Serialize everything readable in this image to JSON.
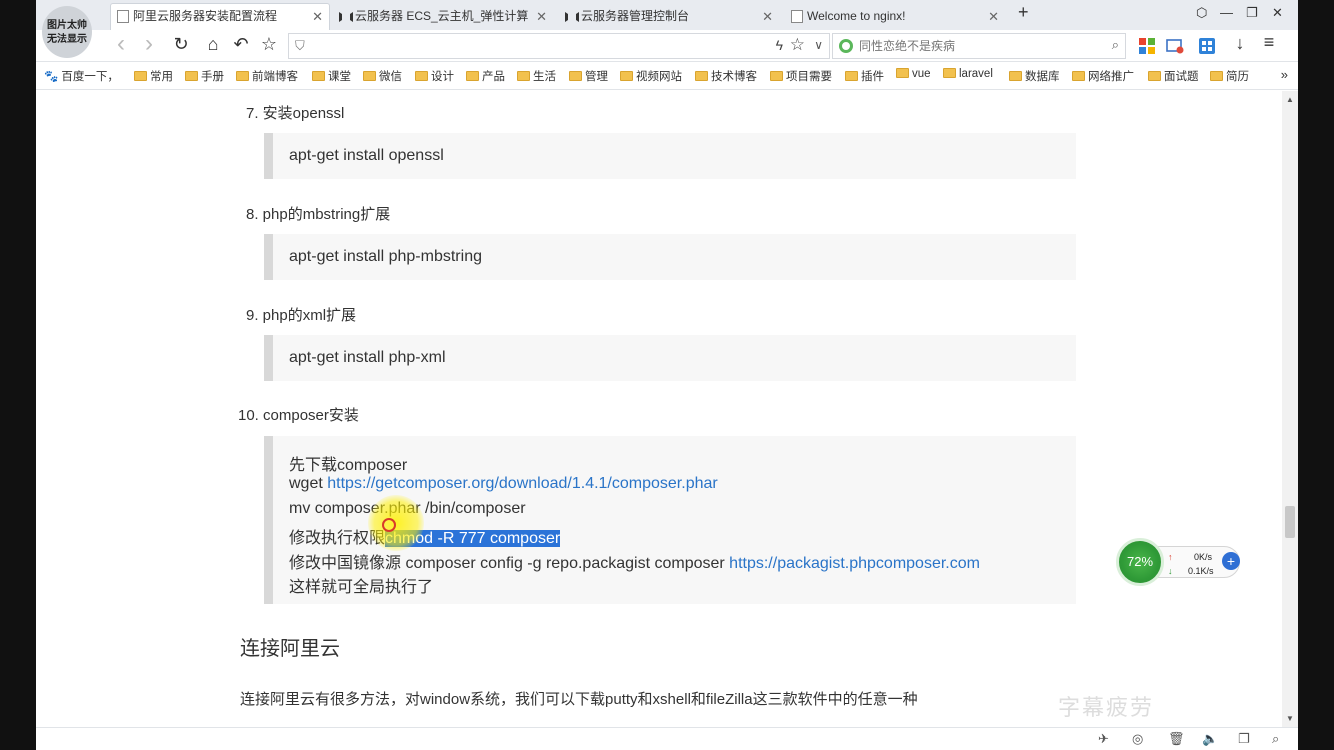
{
  "avatar": {
    "line1": "图片太帅",
    "line2": "无法显示"
  },
  "tabs": [
    {
      "title": "阿里云服务器安装配置流程",
      "icon": "page-icon",
      "active": true
    },
    {
      "title": "云服务器 ECS_云主机_弹性计算",
      "icon": "aliyun-icon",
      "active": false
    },
    {
      "title": "云服务器管理控制台",
      "icon": "aliyun-icon",
      "active": false
    },
    {
      "title": "Welcome to nginx!",
      "icon": "page-icon",
      "active": false
    }
  ],
  "tab_close": "✕",
  "new_tab": "+",
  "window": {
    "skin": "⬡",
    "minimize": "—",
    "restore": "❐",
    "close": "✕"
  },
  "nav": {
    "back": "‹",
    "forward": "›",
    "reload": "↻",
    "home": "⌂",
    "undo": "↶",
    "fav": "☆"
  },
  "address": {
    "value": "",
    "shield": "⛉",
    "bolt": "ϟ",
    "star": "☆",
    "dropdown": "∨"
  },
  "search": {
    "placeholder": "同性恋绝不是疾病",
    "go": "⌕"
  },
  "toolbar_right": {
    "download": "↓",
    "menu": "≡"
  },
  "bookmarks": [
    {
      "label": "百度一下，",
      "type": "paw"
    },
    {
      "label": "常用",
      "type": "folder"
    },
    {
      "label": "手册",
      "type": "folder"
    },
    {
      "label": "前端博客",
      "type": "folder"
    },
    {
      "label": "课堂",
      "type": "folder"
    },
    {
      "label": "微信",
      "type": "folder"
    },
    {
      "label": "设计",
      "type": "folder"
    },
    {
      "label": "产品",
      "type": "folder"
    },
    {
      "label": "生活",
      "type": "folder"
    },
    {
      "label": "管理",
      "type": "folder"
    },
    {
      "label": "视频网站",
      "type": "folder"
    },
    {
      "label": "技术博客",
      "type": "folder"
    },
    {
      "label": "项目需要",
      "type": "folder"
    },
    {
      "label": "插件",
      "type": "folder"
    },
    {
      "label": "vue",
      "type": "folder"
    },
    {
      "label": "laravel",
      "type": "folder"
    },
    {
      "label": "数据库",
      "type": "folder"
    },
    {
      "label": "网络推广",
      "type": "folder"
    },
    {
      "label": "面试题",
      "type": "folder"
    },
    {
      "label": "简历",
      "type": "folder"
    }
  ],
  "bookmarks_more": "»",
  "steps": [
    {
      "label": "7. 安装openssl",
      "code": "apt-get install openssl"
    },
    {
      "label": "8. php的mbstring扩展",
      "code": "apt-get install php-mbstring"
    },
    {
      "label": "9. php的xml扩展",
      "code": "apt-get install php-xml"
    },
    {
      "label": "10. composer安装"
    }
  ],
  "composer": {
    "line1": "先下载composer",
    "line2_prefix": "wget ",
    "line2_link": "https://getcomposer.org/download/1.4.1/composer.phar",
    "line3": "mv composer.phar /bin/composer",
    "line4_prefix": "修改执行权限",
    "line4_selected": "chmod -R 777 composer",
    "line5_prefix": "修改中国镜像源 composer config -g repo.packagist composer ",
    "line5_link": "https://packagist.phpcomposer.com",
    "line6": "这样就可全局执行了"
  },
  "section_title": "连接阿里云",
  "paragraph": "连接阿里云有很多方法，对window系统，我们可以下载putty和xshell和fileZilla这三款软件中的任意一种",
  "speed_widget": {
    "percent": "72%",
    "upload": "0K/s",
    "download": "0.1K/s",
    "plus": "+"
  },
  "scrollbar": {
    "up": "▲",
    "down": "▼"
  },
  "watermark": "字幕疲劳"
}
